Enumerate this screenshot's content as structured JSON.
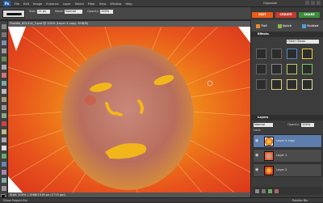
{
  "menubar": {
    "logo": "Ps",
    "items": [
      "File",
      "Edit",
      "Image",
      "Enhance",
      "Layer",
      "Select",
      "Filter",
      "View",
      "Window",
      "Help"
    ],
    "organizer": "Organizer"
  },
  "options": {
    "size_label": "Size:",
    "size_value": "11 px",
    "mode_label": "Mode:",
    "mode_value": "Normal",
    "opacity_label": "Opacity:",
    "opacity_value": "100%"
  },
  "mode_tabs": {
    "edit": "EDIT",
    "create": "CREATE",
    "share": "SHARE"
  },
  "document": {
    "title": "Freddie_001414_3.psd @ 100% (Layer 4 copy, RGB/8)",
    "status": "Stall: 100% | 1568/1316 px (1715 ppi)"
  },
  "bins": {
    "left": "Show Project Bin",
    "right": "Palette Bin"
  },
  "panel_buttons": {
    "full": "Full",
    "quick": "Quick",
    "guided": "Guided"
  },
  "effects": {
    "title": "Effects",
    "filter_value": "Outer Glows"
  },
  "layers": {
    "title": "Layers",
    "blend": "Normal",
    "opacity_label": "Opacity:",
    "opacity_value": "100%",
    "lock_label": "Lock:",
    "rows": [
      {
        "name": "Layer 4 copy"
      },
      {
        "name": "Layer 1"
      },
      {
        "name": "Layer 2"
      }
    ]
  },
  "colors": {
    "edit_tab": "#e85c1a",
    "create_tab": "#c33b2b",
    "share_tab": "#3d8c3b",
    "layer_selected": "#5d7dad"
  }
}
